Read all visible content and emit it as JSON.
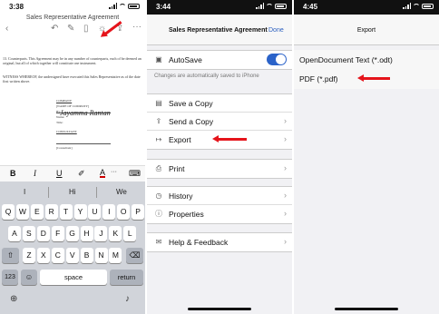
{
  "panel1": {
    "time": "3:38",
    "doc_title": "Sales Representative Agreement",
    "body_para1": "13. Counterparts. This Agreement may be in any number of counterparts, each of be deemed an original, but all of which together will constitute one instrument.",
    "body_para2": "WITNESS WHEREOF, the undersigned have executed this Sales Representative as of the date first written above.",
    "company_label": "COMPANY",
    "name_of_company": "[NAME OF COMPANY]",
    "by_label": "By:",
    "name_label": "Name:",
    "title_label": "Title:",
    "consultant_label": "CONSULTANT",
    "signature_text": "Jayamma Rantan",
    "signed_label": "[Consultant]",
    "format_bold": "B",
    "format_italic": "I",
    "format_underline": "U",
    "format_color": "A",
    "suggestions": [
      "I",
      "Hi",
      "We"
    ],
    "keys_row1": [
      "Q",
      "W",
      "E",
      "R",
      "T",
      "Y",
      "U",
      "I",
      "O",
      "P"
    ],
    "keys_row2": [
      "A",
      "S",
      "D",
      "F",
      "G",
      "H",
      "J",
      "K",
      "L"
    ],
    "keys_row3": [
      "Z",
      "X",
      "C",
      "V",
      "B",
      "N",
      "M"
    ],
    "key_123": "123",
    "key_space": "space",
    "key_return": "return"
  },
  "panel2": {
    "time": "3:44",
    "title": "Sales Representative Agreement",
    "done": "Done",
    "autosave_label": "AutoSave",
    "autosave_on": true,
    "autosave_note": "Changes are automatically saved to iPhone",
    "menu1": [
      {
        "label": "Save a Copy",
        "icon": "doc-icon"
      },
      {
        "label": "Send a Copy",
        "icon": "share-icon"
      },
      {
        "label": "Export",
        "icon": "export-icon"
      }
    ],
    "print_label": "Print",
    "menu2": [
      {
        "label": "History",
        "icon": "clock-icon"
      },
      {
        "label": "Properties",
        "icon": "info-icon"
      }
    ],
    "help_label": "Help & Feedback"
  },
  "panel3": {
    "time": "4:45",
    "title": "Export",
    "options": [
      "OpenDocument Text (*.odt)",
      "PDF (*.pdf)"
    ]
  },
  "colors": {
    "accent": "#2b63c9",
    "arrow": "#e5141b",
    "keyboard": "#d1d4da"
  }
}
